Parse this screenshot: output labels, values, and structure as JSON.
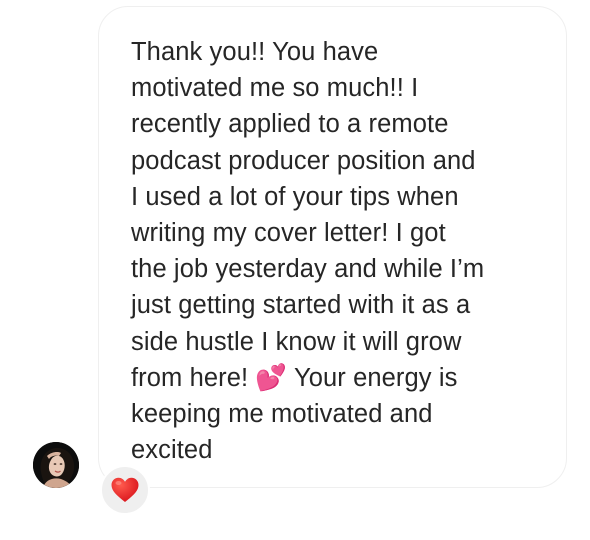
{
  "message": {
    "text": "Thank you!! You have\nmotivated me so much!! I\nrecently applied to a remote\npodcast producer position and\nI used a lot of your tips when\nwriting my cover letter! I got\nthe job yesterday and while I’m\njust getting started with it as a\nside hustle I know it will grow\nfrom here! 💕 Your energy is\nkeeping me motivated and\nexcited"
  },
  "sender": {
    "avatar_icon": "profile-photo"
  },
  "reaction": {
    "icon": "red-heart-icon",
    "color": "#e0201e"
  },
  "colors": {
    "bubble_border": "#efefef",
    "text": "#262626",
    "reaction_bg": "#efefef"
  }
}
